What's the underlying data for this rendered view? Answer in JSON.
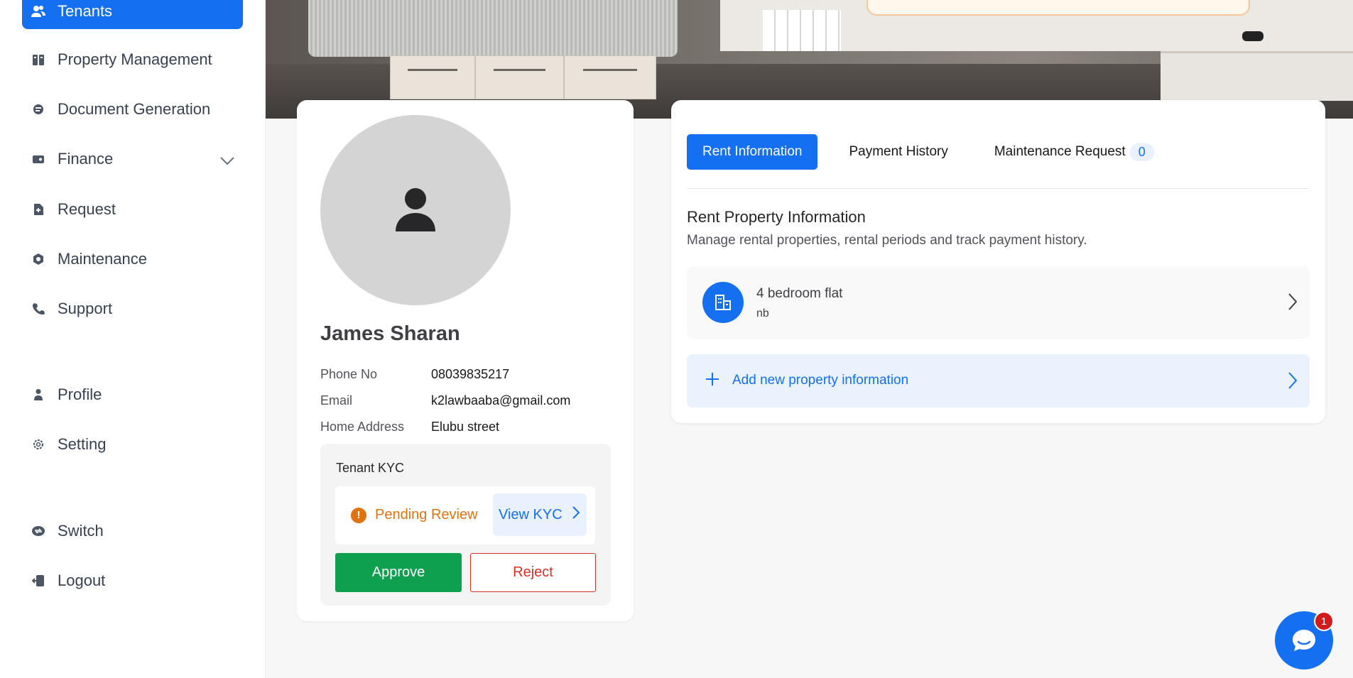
{
  "sidebar": {
    "items": [
      {
        "label": "Tenants",
        "icon": "users-icon",
        "active": true
      },
      {
        "label": "Property Management",
        "icon": "building-icon"
      },
      {
        "label": "Document Generation",
        "icon": "document-icon"
      },
      {
        "label": "Finance",
        "icon": "wallet-icon",
        "has_submenu": true
      },
      {
        "label": "Request",
        "icon": "request-icon"
      },
      {
        "label": "Maintenance",
        "icon": "wrench-icon"
      },
      {
        "label": "Support",
        "icon": "phone-icon"
      },
      {
        "label": "Profile",
        "icon": "user-icon"
      },
      {
        "label": "Setting",
        "icon": "gear-icon"
      },
      {
        "label": "Switch",
        "icon": "switch-icon"
      },
      {
        "label": "Logout",
        "icon": "logout-icon"
      }
    ]
  },
  "tenant": {
    "name": "James Sharan",
    "phone_label": "Phone No",
    "phone": "08039835217",
    "email_label": "Email",
    "email": "k2lawbaaba@gmail.com",
    "address_label": "Home Address",
    "address": "Elubu street",
    "kyc": {
      "title": "Tenant KYC",
      "status": "Pending Review",
      "view_label": "View KYC",
      "approve_label": "Approve",
      "reject_label": "Reject"
    }
  },
  "rent": {
    "tabs": [
      {
        "label": "Rent Information",
        "active": true
      },
      {
        "label": "Payment History"
      },
      {
        "label": "Maintenance Request",
        "count": "0"
      }
    ],
    "title": "Rent Property Information",
    "description": "Manage rental properties, rental periods and track payment history.",
    "property": {
      "name": "4 bedroom flat",
      "subtitle": "nb"
    },
    "add_label": "Add new property information"
  },
  "chat": {
    "badge": "1"
  },
  "colors": {
    "accent": "#1470f0",
    "approve": "#0e9f4f",
    "reject": "#d93026",
    "pending": "#e0730f"
  }
}
